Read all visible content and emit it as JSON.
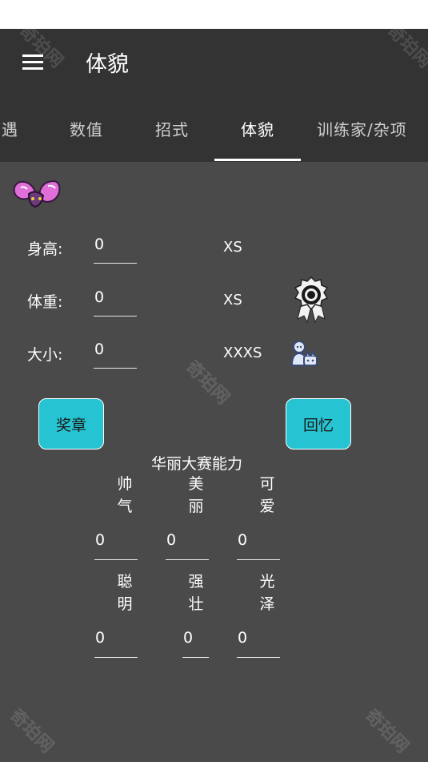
{
  "app": {
    "title": "体貌",
    "accent": "#26c4d2"
  },
  "tabs": [
    {
      "label": "遇"
    },
    {
      "label": "数值"
    },
    {
      "label": "招式"
    },
    {
      "label": "体貌",
      "active": true
    },
    {
      "label": "训练家/杂项"
    }
  ],
  "physique": {
    "height_label": "身高:",
    "height_value": "0",
    "height_rank": "XS",
    "weight_label": "体重:",
    "weight_value": "0",
    "weight_rank": "XS",
    "size_label": "大小:",
    "size_value": "0",
    "size_rank": "XXXS"
  },
  "buttons": {
    "ribbons": "奖章",
    "memories": "回忆"
  },
  "contest": {
    "title": "华丽大赛能力",
    "cool_label": "帅气",
    "cool_value": "0",
    "beauty_label": "美丽",
    "beauty_value": "0",
    "cute_label": "可爱",
    "cute_value": "0",
    "smart_label": "聪明",
    "smart_value": "0",
    "tough_label": "强壮",
    "tough_value": "0",
    "sheen_label": "光泽",
    "sheen_value": "0"
  },
  "watermark": "奇珀网"
}
